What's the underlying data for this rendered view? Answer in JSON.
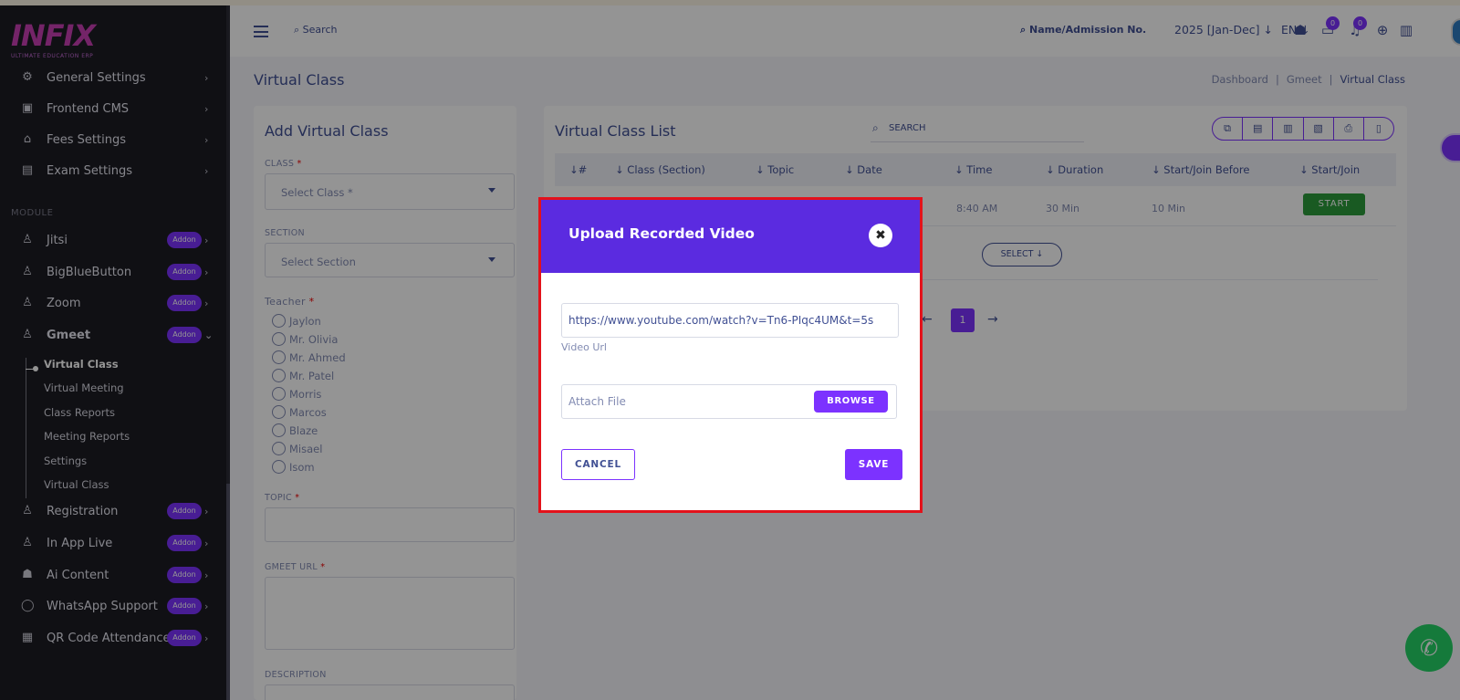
{
  "logo": {
    "text": "INFIX",
    "tagline": "ULTIMATE EDUCATION ERP"
  },
  "sidebar": {
    "items": [
      {
        "label": "General Settings",
        "icon": "gears-icon"
      },
      {
        "label": "Frontend CMS",
        "icon": "monitor-icon"
      },
      {
        "label": "Fees Settings",
        "icon": "bank-icon"
      },
      {
        "label": "Exam Settings",
        "icon": "book-icon"
      }
    ],
    "module_heading": "MODULE",
    "modules": [
      {
        "label": "Jitsi",
        "badge": "Addon"
      },
      {
        "label": "BigBlueButton",
        "badge": "Addon"
      },
      {
        "label": "Zoom",
        "badge": "Addon"
      },
      {
        "label": "Gmeet",
        "badge": "Addon"
      }
    ],
    "gmeet_sub": [
      "Virtual Class",
      "Virtual Meeting",
      "Class Reports",
      "Meeting Reports",
      "Settings",
      "Virtual Class"
    ],
    "modules_after": [
      {
        "label": "Registration",
        "badge": "Addon"
      },
      {
        "label": "In App Live",
        "badge": "Addon"
      },
      {
        "label": "Ai Content",
        "badge": "Addon"
      },
      {
        "label": "WhatsApp Support",
        "badge": "Addon"
      },
      {
        "label": "QR Code Attendance",
        "badge": "Addon"
      }
    ]
  },
  "header": {
    "search_label": "Search",
    "student_search_label": "Name/Admission No.",
    "year": "2025 [Jan-Dec]",
    "lang": "EN",
    "message_count": "0",
    "notification_count": "0"
  },
  "page": {
    "title": "Virtual Class",
    "breadcrumb": [
      "Dashboard",
      "Gmeet",
      "Virtual Class"
    ]
  },
  "form": {
    "title": "Add Virtual Class",
    "class_label": "CLASS",
    "class_placeholder": "Select Class *",
    "section_label": "SECTION",
    "section_placeholder": "Select Section",
    "teacher_label": "Teacher",
    "teachers": [
      "Jaylon",
      "Mr. Olivia",
      "Mr. Ahmed",
      "Mr. Patel",
      "Morris",
      "Marcos",
      "Blaze",
      "Misael",
      "Isom"
    ],
    "topic_label": "TOPIC",
    "url_label": "GMEET URL",
    "description_label": "DESCRIPTION",
    "required_mark": "*"
  },
  "list": {
    "title": "Virtual Class List",
    "search_placeholder": "SEARCH",
    "columns": [
      "#",
      "Class (Section)",
      "Topic",
      "Date",
      "Time",
      "Duration",
      "Start/Join Before",
      "Start/Join"
    ],
    "row": {
      "time": "8:40 AM",
      "duration": "30 Min",
      "before": "10 Min",
      "action": "START"
    },
    "select_label": "SELECT",
    "page": "1"
  },
  "modal": {
    "title": "Upload Recorded Video",
    "url_value": "https://www.youtube.com/watch?v=Tn6-PIqc4UM&t=5s",
    "url_label": "Video Url",
    "attach_placeholder": "Attach File",
    "browse_label": "BROWSE",
    "cancel_label": "CANCEL",
    "save_label": "SAVE"
  },
  "colors": {
    "accent": "#7c32ff",
    "modal_header": "#5b2be0",
    "start_green": "#2b9b3b",
    "highlight": "#e3121b"
  }
}
